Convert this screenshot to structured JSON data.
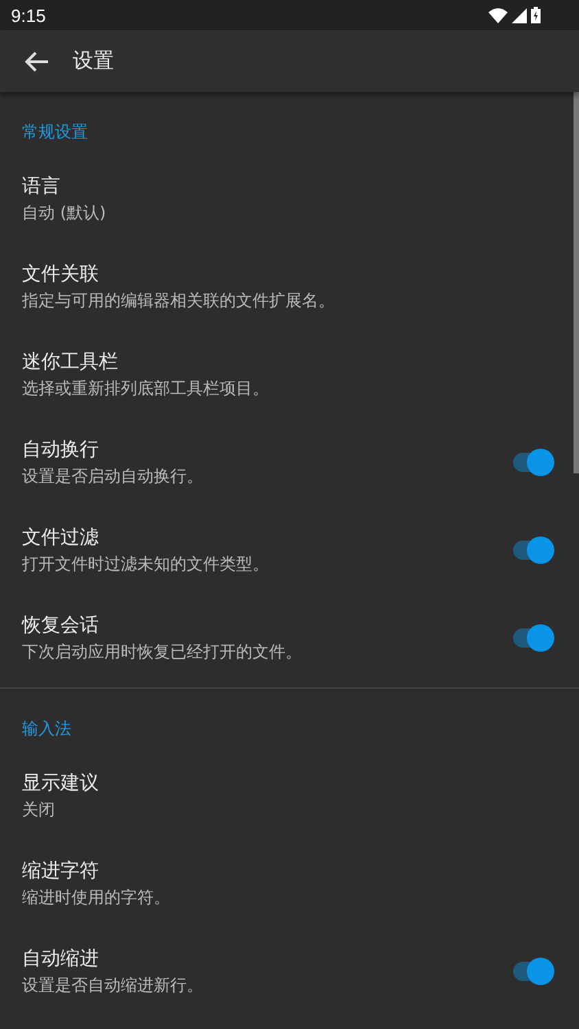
{
  "status_bar": {
    "time": "9:15"
  },
  "app_bar": {
    "title": "设置"
  },
  "sections": [
    {
      "header": "常规设置",
      "items": [
        {
          "kind": "text",
          "title": "语言",
          "summary": "自动 (默认)"
        },
        {
          "kind": "text",
          "title": "文件关联",
          "summary": "指定与可用的编辑器相关联的文件扩展名。"
        },
        {
          "kind": "text",
          "title": "迷你工具栏",
          "summary": "选择或重新排列底部工具栏项目。"
        },
        {
          "kind": "switch",
          "title": "自动换行",
          "summary": "设置是否启动自动换行。",
          "on": true
        },
        {
          "kind": "switch",
          "title": "文件过滤",
          "summary": "打开文件时过滤未知的文件类型。",
          "on": true
        },
        {
          "kind": "switch",
          "title": "恢复会话",
          "summary": "下次启动应用时恢复已经打开的文件。",
          "on": true
        }
      ]
    },
    {
      "header": "输入法",
      "items": [
        {
          "kind": "text",
          "title": "显示建议",
          "summary": "关闭"
        },
        {
          "kind": "text",
          "title": "缩进字符",
          "summary": "缩进时使用的字符。"
        },
        {
          "kind": "switch",
          "title": "自动缩进",
          "summary": "设置是否自动缩进新行。",
          "on": true
        }
      ]
    }
  ]
}
